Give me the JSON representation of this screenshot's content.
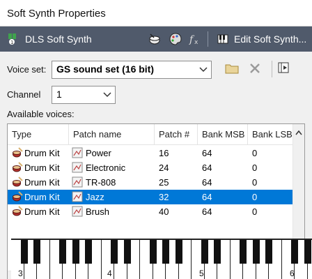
{
  "window": {
    "title": "Soft Synth Properties"
  },
  "toolbar": {
    "plugin_name": "DLS Soft Synth",
    "edit_label": "Edit Soft Synth..."
  },
  "voice_set": {
    "label": "Voice set:",
    "value": "GS sound set (16 bit)"
  },
  "channel": {
    "label": "Channel",
    "value": "1"
  },
  "available_voices_label": "Available voices:",
  "voices_table": {
    "headers": [
      "Type",
      "Patch name",
      "Patch #",
      "Bank MSB",
      "Bank LSB"
    ],
    "rows": [
      {
        "type": "Drum Kit",
        "patch_name": "Power",
        "patch_num": "16",
        "bank_msb": "64",
        "bank_lsb": "0",
        "selected": false
      },
      {
        "type": "Drum Kit",
        "patch_name": "Electronic",
        "patch_num": "24",
        "bank_msb": "64",
        "bank_lsb": "0",
        "selected": false
      },
      {
        "type": "Drum Kit",
        "patch_name": "TR-808",
        "patch_num": "25",
        "bank_msb": "64",
        "bank_lsb": "0",
        "selected": false
      },
      {
        "type": "Drum Kit",
        "patch_name": "Jazz",
        "patch_num": "32",
        "bank_msb": "64",
        "bank_lsb": "0",
        "selected": true
      },
      {
        "type": "Drum Kit",
        "patch_name": "Brush",
        "patch_num": "40",
        "bank_msb": "64",
        "bank_lsb": "0",
        "selected": false
      }
    ]
  },
  "keyboard": {
    "octave_labels": [
      "3",
      "4",
      "5",
      "6"
    ]
  },
  "colors": {
    "selection": "#0078d7",
    "toolbar_bg": "#505a6b",
    "drum_icon_red": "#b5322e"
  }
}
